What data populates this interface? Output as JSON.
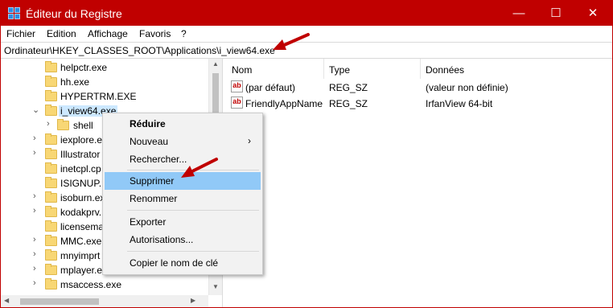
{
  "window": {
    "title": "Éditeur du Registre",
    "minimize": "—",
    "maximize": "☐",
    "close": "✕"
  },
  "menubar": [
    "Fichier",
    "Edition",
    "Affichage",
    "Favoris",
    "?"
  ],
  "address": "Ordinateur\\HKEY_CLASSES_ROOT\\Applications\\i_view64.exe",
  "tree": {
    "items": [
      {
        "label": "helpctr.exe",
        "expanded": false,
        "has_children": false
      },
      {
        "label": "hh.exe",
        "expanded": false,
        "has_children": false
      },
      {
        "label": "HYPERTRM.EXE",
        "expanded": false,
        "has_children": false
      },
      {
        "label": "i_view64.exe",
        "expanded": true,
        "has_children": true,
        "selected": true
      },
      {
        "label": "shell",
        "expanded": false,
        "has_children": true,
        "child": true
      },
      {
        "label": "iexplore.e",
        "expanded": false,
        "has_children": true
      },
      {
        "label": "Illustrator",
        "expanded": false,
        "has_children": true
      },
      {
        "label": "inetcpl.cp",
        "expanded": false,
        "has_children": false
      },
      {
        "label": "ISIGNUP.E",
        "expanded": false,
        "has_children": false
      },
      {
        "label": "isoburn.ex",
        "expanded": false,
        "has_children": true
      },
      {
        "label": "kodakprv.",
        "expanded": false,
        "has_children": true
      },
      {
        "label": "licensema",
        "expanded": false,
        "has_children": false
      },
      {
        "label": "MMC.exe",
        "expanded": false,
        "has_children": true
      },
      {
        "label": "mnyimprt",
        "expanded": false,
        "has_children": true
      },
      {
        "label": "mplayer.e",
        "expanded": false,
        "has_children": true
      },
      {
        "label": "msaccess.exe",
        "expanded": false,
        "has_children": true
      }
    ]
  },
  "values": {
    "headers": {
      "name": "Nom",
      "type": "Type",
      "data": "Données"
    },
    "rows": [
      {
        "name": "(par défaut)",
        "type": "REG_SZ",
        "data": "(valeur non définie)"
      },
      {
        "name": "FriendlyAppName",
        "type": "REG_SZ",
        "data": "IrfanView 64-bit"
      }
    ]
  },
  "context_menu": {
    "items": [
      {
        "label": "Réduire",
        "bold": true
      },
      {
        "label": "Nouveau",
        "submenu": true
      },
      {
        "label": "Rechercher..."
      },
      {
        "label": "Supprimer",
        "highlighted": true
      },
      {
        "label": "Renommer"
      },
      {
        "label": "Exporter"
      },
      {
        "label": "Autorisations..."
      },
      {
        "label": "Copier le nom de clé"
      }
    ]
  },
  "colors": {
    "titlebar": "#c00000",
    "highlight": "#91c9f7",
    "annotation_arrow": "#c00000"
  }
}
